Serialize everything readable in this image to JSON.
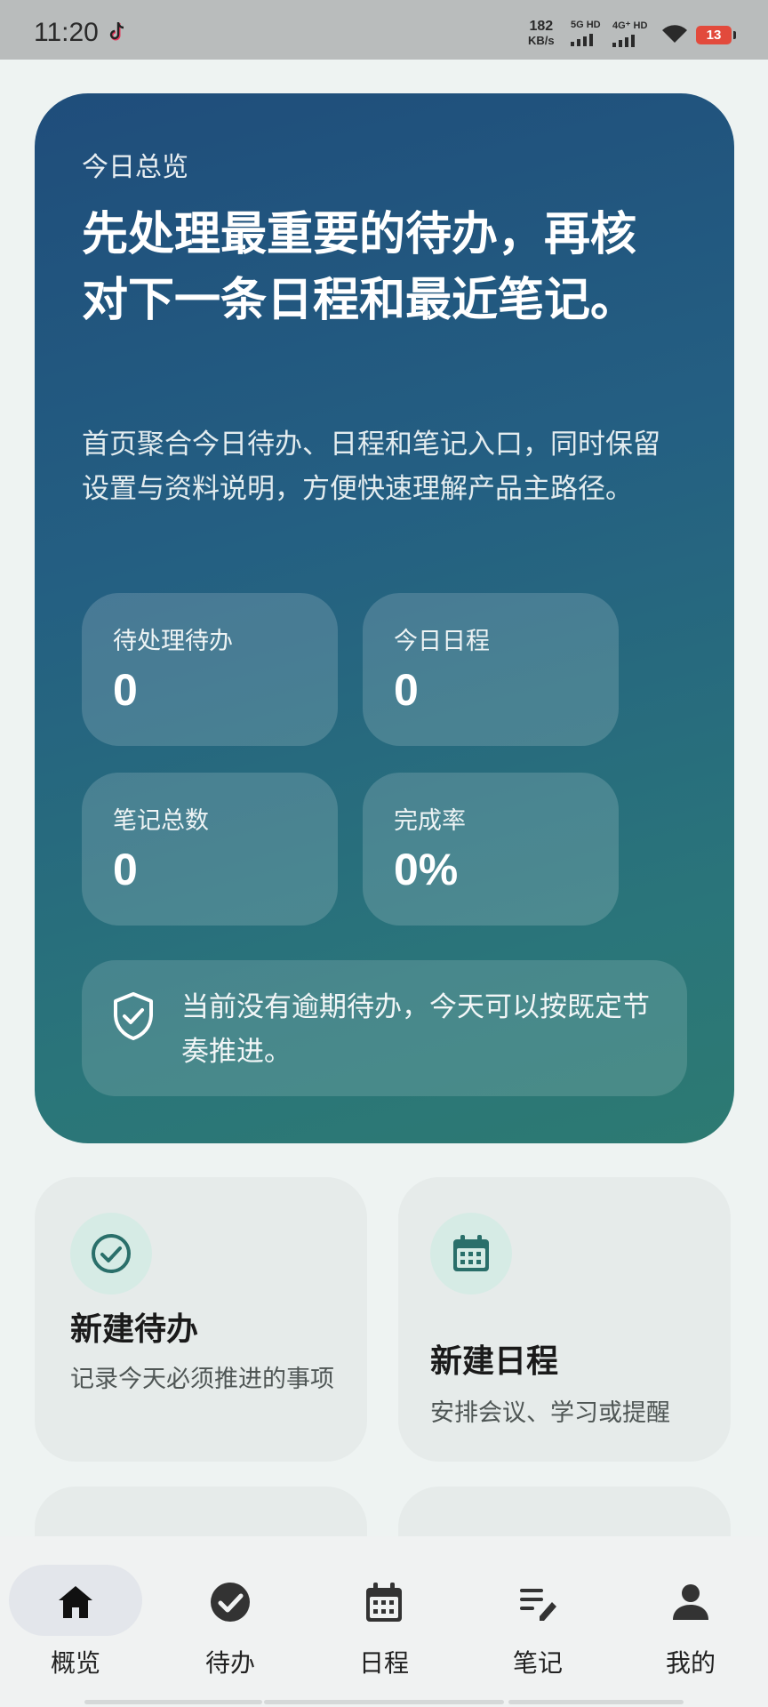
{
  "status_bar": {
    "time": "11:20",
    "net_speed_value": "182",
    "net_speed_unit": "KB/s",
    "sim1": "5G HD",
    "sim2": "4G⁺ HD",
    "battery": "13"
  },
  "hero": {
    "eyebrow": "今日总览",
    "title": "先处理最重要的待办，再核对下一条日程和最近笔记。",
    "description": "首页聚合今日待办、日程和笔记入口，同时保留设置与资料说明，方便快速理解产品主路径。",
    "stats": [
      {
        "label": "待处理待办",
        "value": "0"
      },
      {
        "label": "今日日程",
        "value": "0"
      },
      {
        "label": "笔记总数",
        "value": "0"
      },
      {
        "label": "完成率",
        "value": "0%"
      }
    ],
    "notice": "当前没有逾期待办，今天可以按既定节奏推进。"
  },
  "actions": [
    {
      "title": "新建待办",
      "description": "记录今天必须推进的事项",
      "icon": "check-circle-icon"
    },
    {
      "title": "新建日程",
      "description": "安排会议、学习或提醒",
      "icon": "calendar-icon"
    }
  ],
  "bottom_nav": [
    {
      "label": "概览",
      "icon": "home-icon",
      "active": true
    },
    {
      "label": "待办",
      "icon": "check-icon",
      "active": false
    },
    {
      "label": "日程",
      "icon": "calendar-icon",
      "active": false
    },
    {
      "label": "笔记",
      "icon": "notes-icon",
      "active": false
    },
    {
      "label": "我的",
      "icon": "person-icon",
      "active": false
    }
  ],
  "colors": {
    "accent": "#2a6f6a",
    "hero_gradient_start": "#1f4d7b",
    "hero_gradient_end": "#2d7a72"
  }
}
